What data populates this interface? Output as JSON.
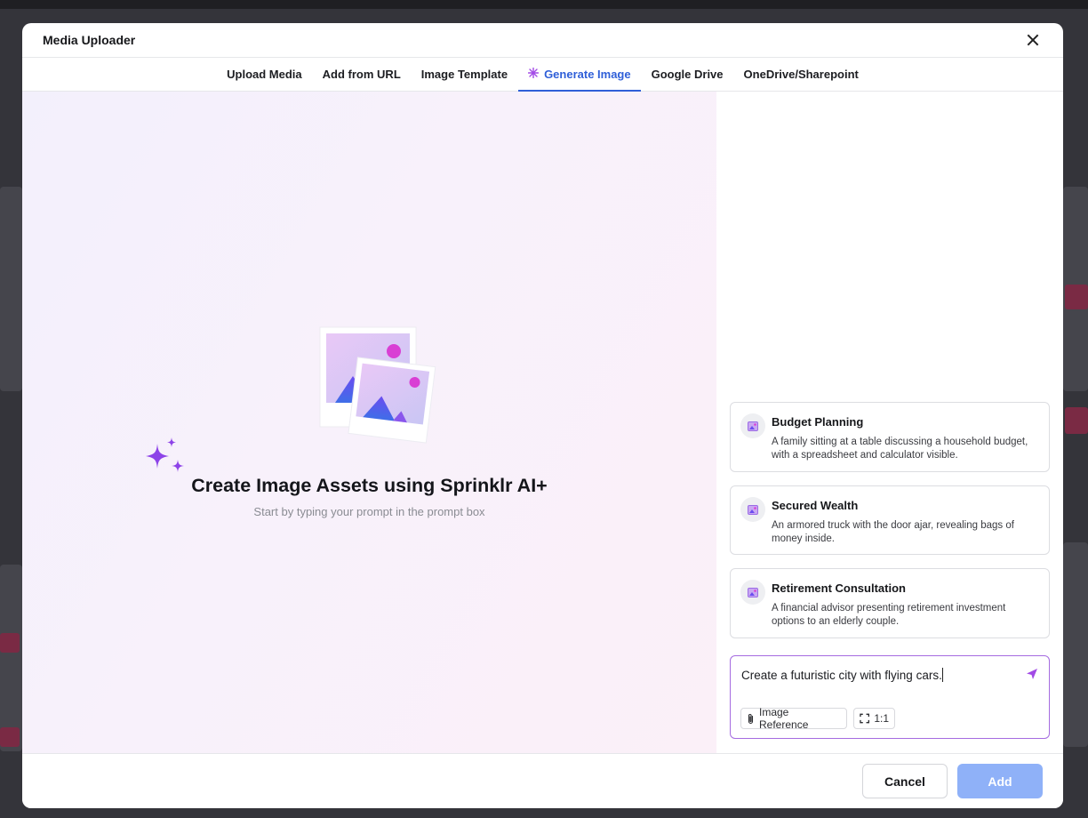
{
  "modal": {
    "title": "Media Uploader"
  },
  "tabs": [
    {
      "label": "Upload Media",
      "active": false
    },
    {
      "label": "Add from URL",
      "active": false
    },
    {
      "label": "Image Template",
      "active": false
    },
    {
      "label": "Generate Image",
      "active": true,
      "icon": "sparkle-icon"
    },
    {
      "label": "Google Drive",
      "active": false
    },
    {
      "label": "OneDrive/Sharepoint",
      "active": false
    }
  ],
  "hero": {
    "title": "Create Image Assets using Sprinklr AI+",
    "subtitle": "Start by typing your prompt in the prompt box"
  },
  "suggestions": [
    {
      "title": "Budget Planning",
      "description": "A family sitting at a table discussing a household budget, with a spreadsheet and calculator visible.",
      "icon": "image-icon"
    },
    {
      "title": "Secured Wealth",
      "description": "An armored truck with the door ajar, revealing bags of money inside.",
      "icon": "image-icon"
    },
    {
      "title": "Retirement Consultation",
      "description": "A financial advisor presenting retirement investment options to an elderly couple.",
      "icon": "image-icon"
    }
  ],
  "prompt": {
    "value": "Create a futuristic city with flying cars.",
    "image_reference_label": "Image Reference",
    "aspect_ratio_label": "1:1"
  },
  "footer": {
    "cancel_label": "Cancel",
    "add_label": "Add"
  },
  "colors": {
    "accent_blue": "#2f5fd8",
    "ai_purple": "#a24ae6",
    "add_button_disabled": "#8fb1f8"
  }
}
